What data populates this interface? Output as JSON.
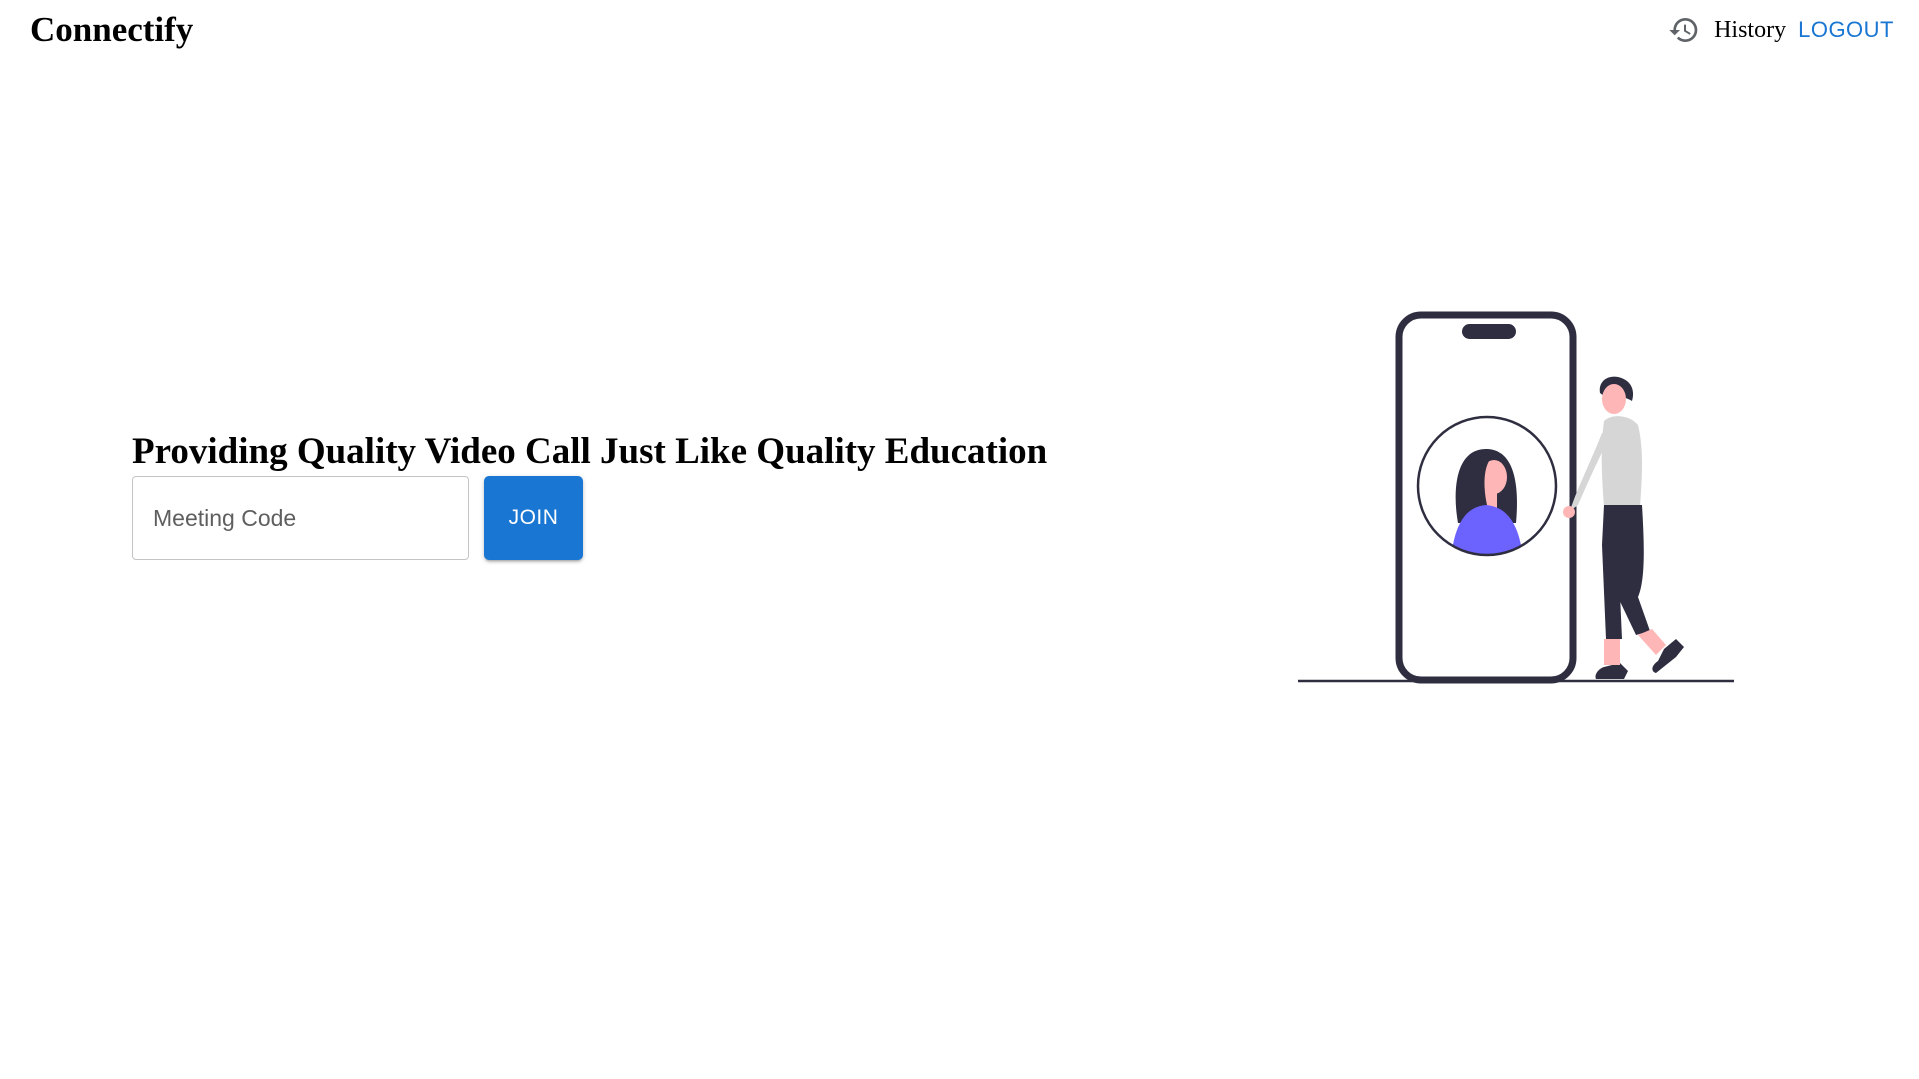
{
  "app": {
    "brand": "Connectify"
  },
  "nav": {
    "history_icon": "history-icon",
    "history_label": "History",
    "logout_label": "LOGOUT"
  },
  "hero": {
    "title": "Providing Quality Video Call Just Like Quality Education",
    "meeting_code": {
      "value": "",
      "placeholder": "Meeting Code"
    },
    "join_label": "JOIN"
  },
  "illustration": {
    "icon": "video-call-illustration",
    "colors": {
      "outline": "#2f2e41",
      "accent": "#6c63ff",
      "skin": "#ffb6b6",
      "shirt": "#d6d6d6"
    }
  },
  "colors": {
    "primary": "#1976d2",
    "text": "#000000",
    "background": "#ffffff"
  }
}
